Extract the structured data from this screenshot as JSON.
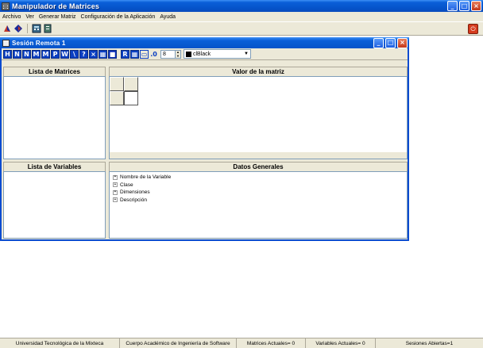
{
  "window": {
    "title": "Manipulador de Matrices",
    "minimize": "_",
    "maximize": "□",
    "close": "×"
  },
  "menu": [
    "Archivo",
    "Ver",
    "Generar Matriz",
    "Configuración de la Aplicación",
    "Ayuda"
  ],
  "toolbar": {
    "icons": [
      "pointer-icon",
      "diamond-icon",
      "calculator-icon",
      "document-icon"
    ],
    "power_icon": "power-icon"
  },
  "session": {
    "title": "Sesión Remota  1",
    "minimize": "_",
    "maximize": "□",
    "close": "×",
    "tools": [
      "H",
      "N",
      "N",
      "M",
      "M",
      "P",
      "W",
      "\\",
      "?",
      "×",
      "▦",
      "■",
      "R",
      "▦",
      "▭",
      ".0"
    ],
    "font_size": "8",
    "color_value": "clBlack",
    "color_swatch": "#000000"
  },
  "panels": {
    "matrix_list": "Lista de Matrices",
    "matrix_value": "Valor de la matriz",
    "variable_list": "Lista de Variables",
    "general_data": "Datos Generales"
  },
  "tree": [
    "Nombre de la Variable",
    "Clase",
    "Dimensiones",
    "Descripción"
  ],
  "status": {
    "university": "Universidad Tecnológica de la Mixteca",
    "academic_body": "Cuerpo Académico de Ingeniería de Software",
    "matrices": "Matrices Actuales= 0",
    "variables": "Variables Actuales= 0",
    "sessions": "Sesiones Abiertas=1"
  },
  "colors": {
    "titlebar": "#0553c9",
    "toolbar_button": "#0b3fc2",
    "face": "#ece9d8"
  }
}
